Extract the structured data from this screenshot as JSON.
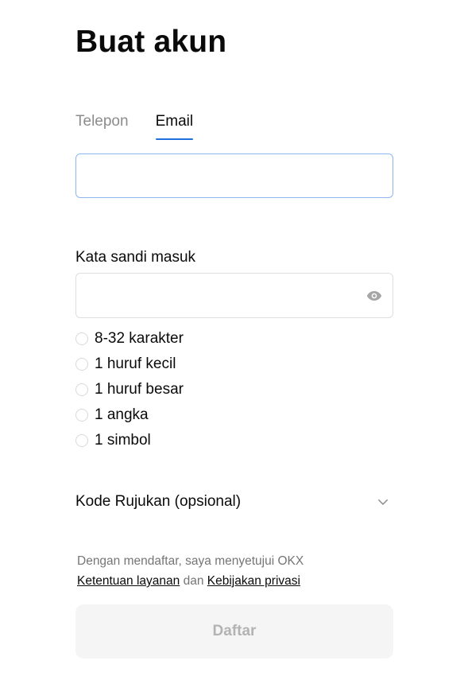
{
  "page": {
    "title": "Buat akun"
  },
  "tabs": [
    {
      "label": "Telepon",
      "active": false
    },
    {
      "label": "Email",
      "active": true
    }
  ],
  "email": {
    "value": "",
    "placeholder": ""
  },
  "password": {
    "label": "Kata sandi masuk",
    "value": "",
    "placeholder": "",
    "toggle_icon": "eye-icon",
    "rules": [
      "8-32 karakter",
      "1 huruf kecil",
      "1 huruf besar",
      "1 angka",
      "1 simbol"
    ]
  },
  "referral": {
    "label": "Kode Rujukan (opsional)",
    "icon": "chevron-down-icon"
  },
  "terms": {
    "prefix": "Dengan mendaftar, saya menyetujui OKX",
    "tos_link": "Ketentuan layanan",
    "joiner": "dan",
    "privacy_link": "Kebijakan privasi"
  },
  "submit": {
    "label": "Daftar",
    "enabled": false
  },
  "colors": {
    "accent": "#1f6fde",
    "input_focus_border": "#8fb6f0",
    "muted_text": "#8c8c8c",
    "disabled_bg": "#f5f5f5",
    "disabled_text": "#b3b3b3"
  }
}
